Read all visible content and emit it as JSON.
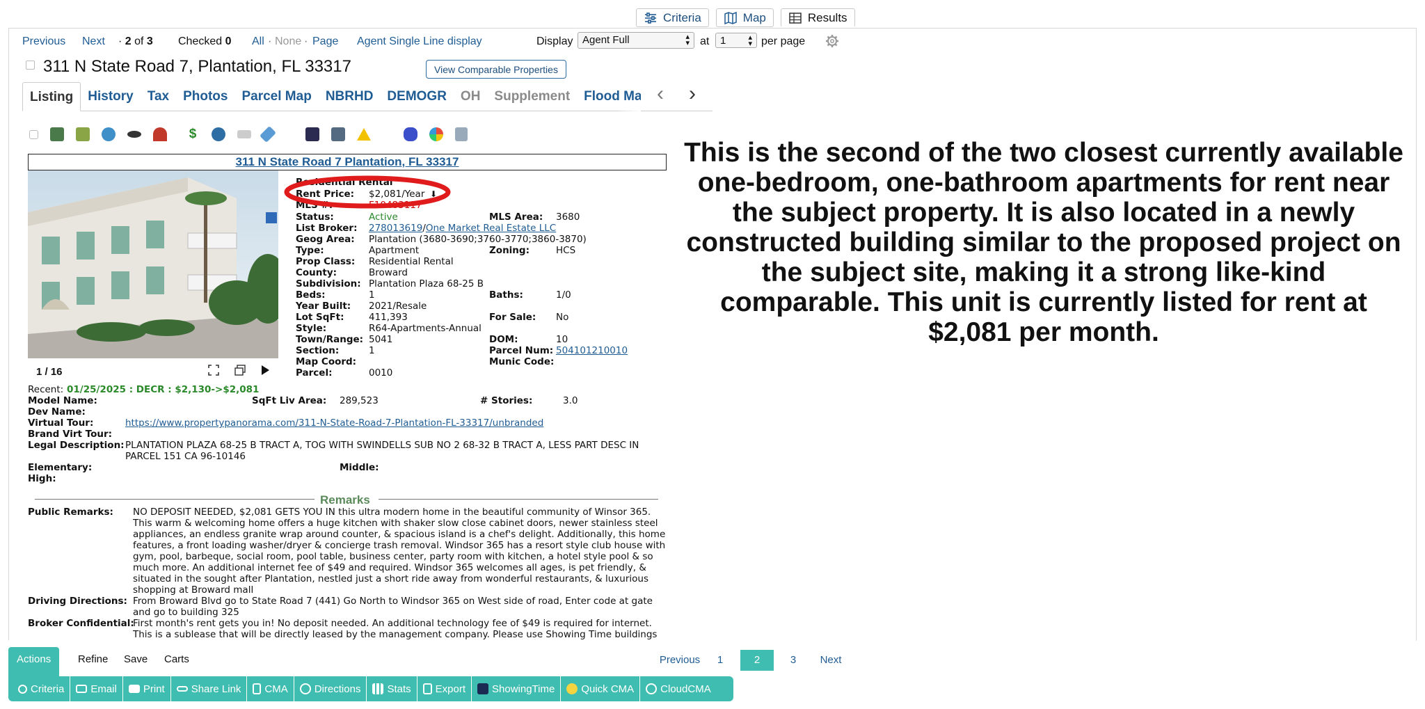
{
  "top_tabs": [
    {
      "label": "Criteria",
      "icon": "sliders-icon"
    },
    {
      "label": "Map",
      "icon": "map-icon"
    },
    {
      "label": "Results",
      "icon": "table-icon"
    }
  ],
  "toolbar": {
    "previous": "Previous",
    "next": "Next",
    "record_prefix": "· ",
    "record_current": "2",
    "record_of": " of ",
    "record_total": "3",
    "checked_label": "Checked ",
    "checked_count": "0",
    "all": "All",
    "sep": "·",
    "none": "None",
    "page": "Page",
    "single_line": "Agent Single Line display",
    "display_label": "Display",
    "display_value": "Agent Full",
    "at_label": "at",
    "per_page_value": "1",
    "per_page_label": "per page"
  },
  "listing": {
    "address": "311 N State Road 7, Plantation, FL 33317",
    "comparable_button": "View Comparable Properties",
    "tabs": [
      "Listing",
      "History",
      "Tax",
      "Photos",
      "Parcel Map",
      "NBRHD",
      "DEMOGR",
      "OH",
      "Supplement",
      "Flood Ma"
    ],
    "address_bar": "311 N State Road 7 Plantation, FL 33317",
    "photo_counter": "1 / 16"
  },
  "details": {
    "property_type": "Residential Rental",
    "rent_price_label": "Rent Price:",
    "rent_price": "$2,081/Year",
    "mls_label": "MLS #:",
    "mls": "F10483117",
    "status_label": "Status:",
    "status": "Active",
    "mls_area_label": "MLS Area:",
    "mls_area": "3680",
    "list_broker_label": "List Broker:",
    "list_broker_id": "278013619",
    "list_broker_sep": "/",
    "list_broker_name": "One Market Real Estate LLC",
    "geog_area_label": "Geog Area:",
    "geog_area": "Plantation (3680-3690;3760-3770;3860-3870)",
    "type_label": "Type:",
    "type": "Apartment",
    "zoning_label": "Zoning:",
    "zoning": "HCS",
    "prop_class_label": "Prop Class:",
    "prop_class": "Residential Rental",
    "county_label": "County:",
    "county": "Broward",
    "subdivision_label": "Subdivision:",
    "subdivision": "Plantation Plaza 68-25 B",
    "beds_label": "Beds:",
    "beds": "1",
    "baths_label": "Baths:",
    "baths": "1/0",
    "year_built_label": "Year Built:",
    "year_built": "2021/Resale",
    "lot_sqft_label": "Lot SqFt:",
    "lot_sqft": "411,393",
    "for_sale_label": "For Sale:",
    "for_sale": "No",
    "style_label": "Style:",
    "style": "R64-Apartments-Annual",
    "town_range_label": "Town/Range:",
    "town_range": "5041",
    "dom_label": "DOM:",
    "dom": "10",
    "section_label": "Section:",
    "section": "1",
    "parcel_num_label": "Parcel Num:",
    "parcel_num": "504101210010",
    "map_coord_label": "Map Coord:",
    "munic_code_label": "Munic Code:",
    "parcel_label": "Parcel:",
    "parcel": "0010",
    "recent_label": "Recent:",
    "recent": "01/25/2025 : DECR : $2,130->$2,081",
    "model_name_label": "Model Name:",
    "sqft_liv_label": "SqFt Liv Area:",
    "sqft_liv": "289,523",
    "stories_label": "# Stories:",
    "stories": "3.0",
    "dev_name_label": "Dev Name:",
    "virtual_tour_label": "Virtual Tour:",
    "virtual_tour": "https://www.propertypanorama.com/311-N-State-Road-7-Plantation-FL-33317/unbranded",
    "brand_virt_label": "Brand Virt Tour:",
    "legal_label": "Legal Description:",
    "legal": "PLANTATION PLAZA 68-25 B TRACT A, TOG WITH SWINDELLS SUB NO 2 68-32 B TRACT A, LESS PART DESC IN PARCEL 151 CA 96-10146",
    "elementary_label": "Elementary:",
    "middle_label": "Middle:",
    "high_label": "High:"
  },
  "remarks": {
    "heading": "Remarks",
    "public_label": "Public Remarks:",
    "public": "NO DEPOSIT NEEDED, $2,081 GETS YOU IN this ultra modern home in the beautiful community of Winsor 365. This warm & welcoming home offers a huge kitchen with shaker slow close cabinet doors, newer stainless steel appliances, an endless granite wrap around counter, & spacious island is a chef's delight. Additionally, this home features, a front loading washer/dryer & concierge trash removal. Windsor 365 has a resort style club house with gym, pool, barbeque, social room, pool table, business center, party room with kitchen, a hotel style pool & so much more. An additional internet fee of $49 and required. Windsor 365 welcomes all ages, is pet friendly, & situated in the sought after Plantation, nestled just a short ride away from wonderful restaurants, & luxurious shopping at Broward mall",
    "driving_label": "Driving Directions:",
    "driving": "From Broward Blvd go to State Road 7 (441) Go North to Windsor 365 on West side of road, Enter code at gate and go to building 325",
    "broker_label": "Broker Confidential:",
    "broker": "First month's rent gets you in! No deposit needed. An additional technology fee of $49 is required for internet. This is a sublease that will be directly leased by the management company. Please use Showing Time buildings"
  },
  "annotation": "This is the second of the two closest currently available one-bedroom, one-bathroom apartments for rent near the subject property. It is also located in a newly constructed building similar to the proposed project on the subject site, making it a strong like-kind comparable. This unit is currently listed for rent at $2,081 per month.",
  "pager": {
    "previous": "Previous",
    "pages": [
      "1",
      "2",
      "3"
    ],
    "current": "2",
    "next": "Next"
  },
  "bottom_tabs": [
    "Actions",
    "Refine",
    "Save",
    "Carts"
  ],
  "actions": [
    {
      "label": "Criteria",
      "icon": "search-icon"
    },
    {
      "label": "Email",
      "icon": "envelope-icon"
    },
    {
      "label": "Print",
      "icon": "printer-icon"
    },
    {
      "label": "Share Link",
      "icon": "link-icon"
    },
    {
      "label": "CMA",
      "icon": "document-icon"
    },
    {
      "label": "Directions",
      "icon": "compass-icon"
    },
    {
      "label": "Stats",
      "icon": "bar-chart-icon"
    },
    {
      "label": "Export",
      "icon": "export-icon"
    },
    {
      "label": "ShowingTime",
      "icon": "showingtime-icon"
    },
    {
      "label": "Quick CMA",
      "icon": "coin-icon"
    },
    {
      "label": "CloudCMA",
      "icon": "cloud-icon"
    }
  ],
  "colors": {
    "accent": "#3fbdb0",
    "link": "#1f5c94",
    "highlight_ring": "#e01b1b",
    "active_status": "#2a8a2a"
  }
}
